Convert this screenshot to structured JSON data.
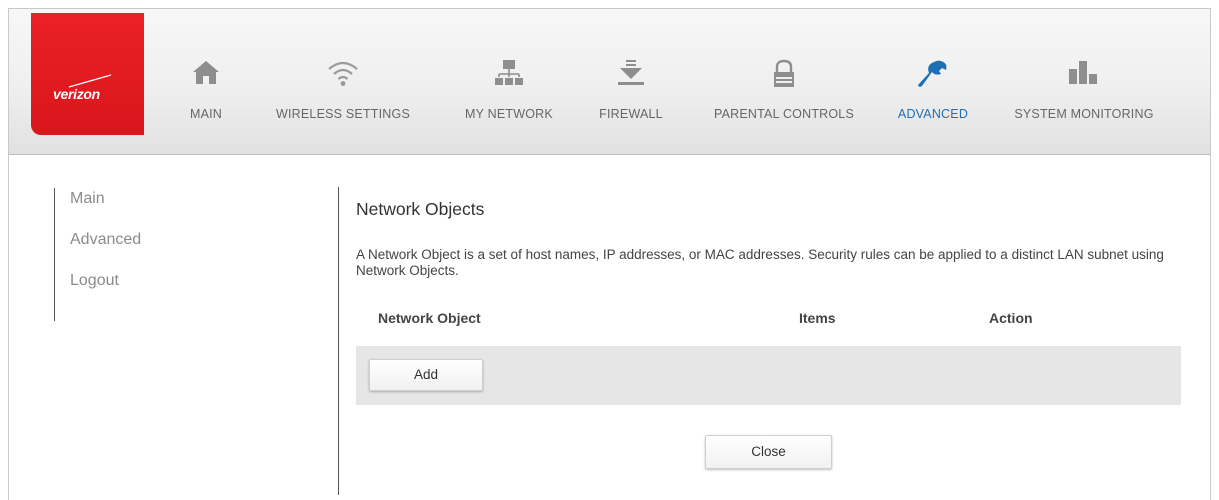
{
  "brand": {
    "logo_text": "verizon",
    "color": "#e3191f"
  },
  "nav": {
    "items": [
      {
        "label": "MAIN",
        "icon": "home-icon"
      },
      {
        "label": "WIRELESS SETTINGS",
        "icon": "wifi-icon"
      },
      {
        "label": "MY NETWORK",
        "icon": "network-icon"
      },
      {
        "label": "FIREWALL",
        "icon": "firewall-icon"
      },
      {
        "label": "PARENTAL CONTROLS",
        "icon": "lock-icon"
      },
      {
        "label": "ADVANCED",
        "icon": "wrench-icon",
        "active": true
      },
      {
        "label": "SYSTEM MONITORING",
        "icon": "bar-chart-icon"
      }
    ],
    "active_color": "#1f6fb5"
  },
  "sidebar": {
    "items": [
      "Main",
      "Advanced",
      "Logout"
    ]
  },
  "main": {
    "title": "Network Objects",
    "description": "A Network Object is a set of host names, IP addresses, or MAC addresses. Security rules can be applied to a distinct LAN subnet using Network Objects.",
    "table": {
      "columns": [
        "Network Object",
        "Items",
        "Action"
      ],
      "add_label": "Add"
    },
    "close_label": "Close"
  }
}
